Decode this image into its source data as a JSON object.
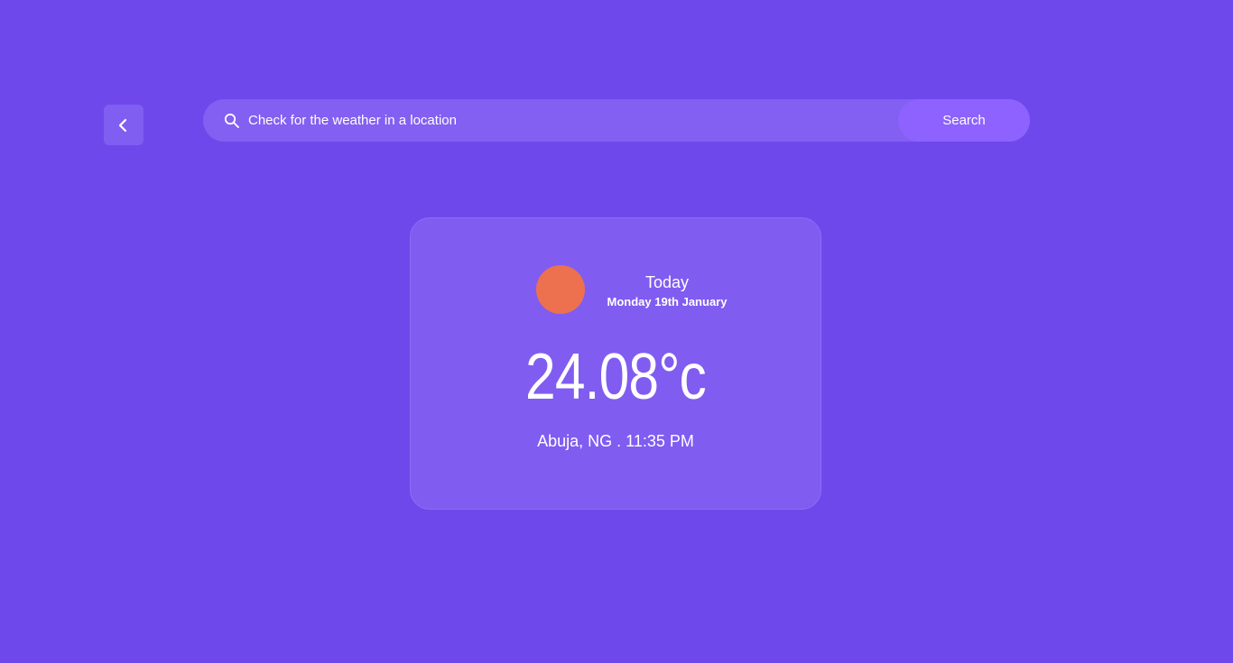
{
  "header": {
    "back_icon": "chevron-left-icon",
    "search": {
      "icon": "search-icon",
      "placeholder": "Check for the weather in a location",
      "value": "",
      "button_label": "Search"
    }
  },
  "weather_card": {
    "icon": "sun-icon",
    "day": "Today",
    "date": "Monday 19th January",
    "temperature": "24.08°c",
    "location_time": "Abuja, NG . 11:35 PM"
  },
  "colors": {
    "background": "#6f48eb",
    "card": "#805cf1",
    "search_bar": "#835ff2",
    "search_button": "#8d62ff",
    "sun": "#ed714f",
    "text": "#ffffff"
  }
}
